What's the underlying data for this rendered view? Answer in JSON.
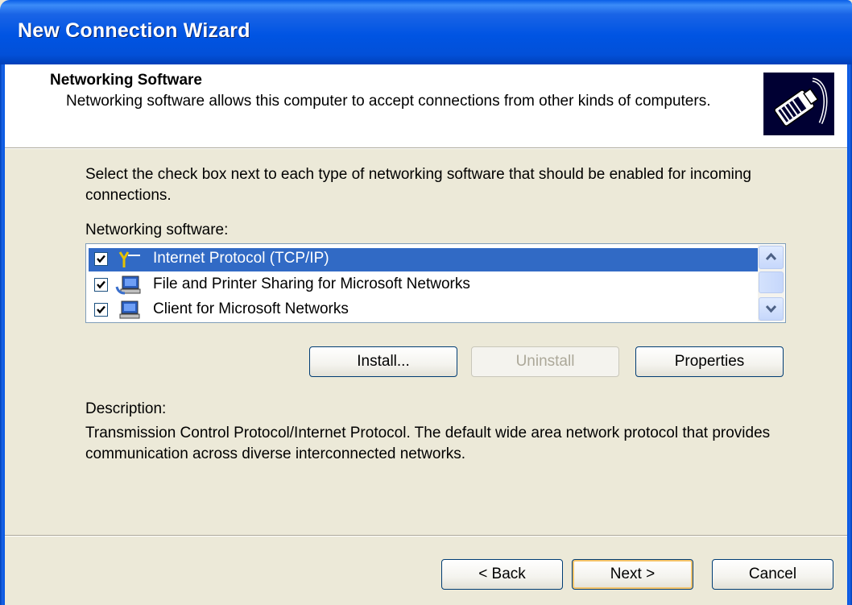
{
  "window": {
    "title": "New Connection Wizard"
  },
  "header": {
    "title": "Networking Software",
    "subtitle": "Networking software allows this computer to accept connections from other kinds of computers.",
    "icon": "network-cable-icon"
  },
  "body": {
    "instruction": "Select the check box next to each type of networking software that should be enabled for incoming connections.",
    "list_label": "Networking software:",
    "items": [
      {
        "label": "Internet Protocol (TCP/IP)",
        "checked": true,
        "selected": true,
        "icon": "protocol-icon"
      },
      {
        "label": "File and Printer Sharing for Microsoft Networks",
        "checked": true,
        "selected": false,
        "icon": "computer-share-icon"
      },
      {
        "label": "Client for Microsoft Networks",
        "checked": true,
        "selected": false,
        "icon": "computer-icon"
      }
    ],
    "buttons": {
      "install": "Install...",
      "uninstall": "Uninstall",
      "properties": "Properties"
    },
    "description_label": "Description:",
    "description": "Transmission Control Protocol/Internet Protocol. The default wide area network protocol that provides communication across diverse interconnected networks."
  },
  "footer": {
    "back": "< Back",
    "next": "Next >",
    "cancel": "Cancel"
  },
  "colors": {
    "titlebar": "#0054e3",
    "selection": "#316ac5",
    "dialog_bg": "#ece9d8"
  }
}
